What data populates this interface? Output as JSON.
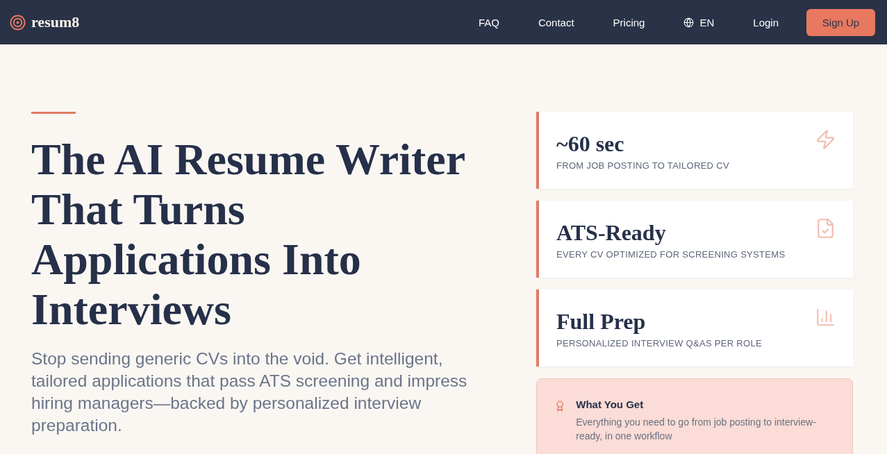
{
  "header": {
    "logo": "resum8",
    "nav": [
      {
        "label": "FAQ"
      },
      {
        "label": "Contact"
      },
      {
        "label": "Pricing"
      }
    ],
    "language": "EN",
    "login": "Login",
    "signup": "Sign Up"
  },
  "hero": {
    "headline": "The AI Resume Writer That Turns Applications Into Interviews",
    "subtitle": "Stop sending generic CVs into the void. Get intelligent, tailored applications that pass ATS screening and impress hiring managers—backed by personalized interview preparation."
  },
  "stats": [
    {
      "value": "~60 sec",
      "caption": "FROM JOB POSTING TO TAILORED CV"
    },
    {
      "value": "ATS-Ready",
      "caption": "EVERY CV OPTIMIZED FOR SCREENING SYSTEMS"
    },
    {
      "value": "Full Prep",
      "caption": "PERSONALIZED INTERVIEW Q&AS PER ROLE"
    }
  ],
  "benefit": {
    "title": "What You Get",
    "text": "Everything you need to go from job posting to interview-ready, in one workflow"
  }
}
